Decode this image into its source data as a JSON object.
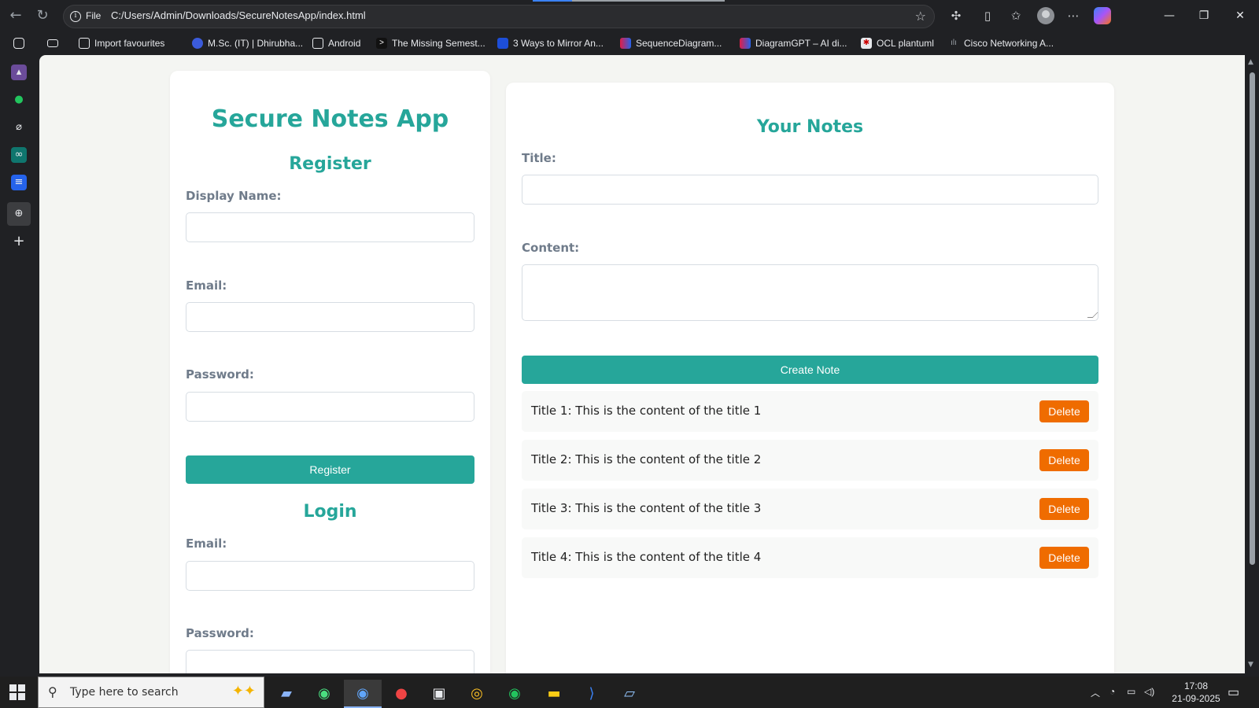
{
  "browser": {
    "address_scheme": "File",
    "url": "C:/Users/Admin/Downloads/SecureNotesApp/index.html",
    "bookmarks": [
      {
        "label": "Import favourites"
      },
      {
        "label": "M.Sc. (IT) | Dhirubha..."
      },
      {
        "label": "Android"
      },
      {
        "label": "The Missing Semest..."
      },
      {
        "label": "3 Ways to Mirror An..."
      },
      {
        "label": "SequenceDiagram..."
      },
      {
        "label": "DiagramGPT – AI di..."
      },
      {
        "label": "OCL plantuml"
      },
      {
        "label": "Cisco Networking A..."
      }
    ]
  },
  "app": {
    "title": "Secure Notes App",
    "register": {
      "heading": "Register",
      "display_name_label": "Display Name:",
      "email_label": "Email:",
      "password_label": "Password:",
      "button_label": "Register"
    },
    "login": {
      "heading": "Login",
      "email_label": "Email:",
      "password_label": "Password:"
    },
    "notes": {
      "heading": "Your Notes",
      "title_label": "Title:",
      "content_label": "Content:",
      "create_button": "Create Note",
      "delete_label": "Delete",
      "items": [
        {
          "text": "Title 1: This is the content of the title 1"
        },
        {
          "text": "Title 2: This is the content of the title 2"
        },
        {
          "text": "Title 3: This is the content of the title 3"
        },
        {
          "text": "Title 4: This is the content of the title 4"
        }
      ]
    }
  },
  "taskbar": {
    "search_placeholder": "Type here to search",
    "time": "17:08",
    "date": "21-09-2025"
  },
  "colors": {
    "accent": "#26a69a",
    "delete": "#ef6c00",
    "label": "#6f7b8a"
  }
}
